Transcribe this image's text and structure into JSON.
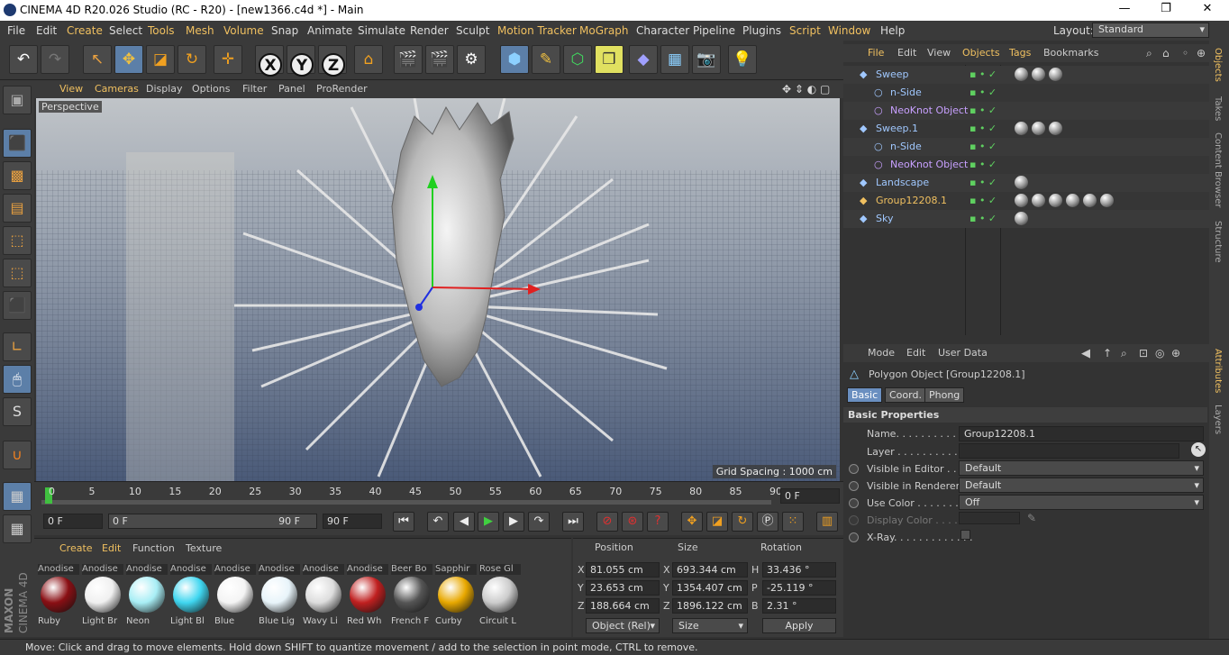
{
  "app": {
    "title": "CINEMA 4D R20.026 Studio (RC - R20) - [new1366.c4d *] - Main",
    "window_minimize": "—",
    "window_maximize": "❐",
    "window_close": "✕"
  },
  "menubar": {
    "items": [
      "File",
      "Edit",
      "Create",
      "Select",
      "Tools",
      "Mesh",
      "Volume",
      "Snap",
      "Animate",
      "Simulate",
      "Render",
      "Sculpt",
      "Motion Tracker",
      "MoGraph",
      "Character",
      "Pipeline",
      "Plugins",
      "Script",
      "Window",
      "Help"
    ],
    "layout_label": "Layout:",
    "layout_value": "Standard"
  },
  "toolbar": {
    "axis_x": "X",
    "axis_y": "Y",
    "axis_z": "Z"
  },
  "viewport": {
    "menu": [
      "View",
      "Cameras",
      "Display",
      "Options",
      "Filter",
      "Panel",
      "ProRender"
    ],
    "camera_label": "Perspective",
    "grid_spacing": "Grid Spacing : 1000 cm"
  },
  "timeline": {
    "ticks": [
      "0",
      "5",
      "10",
      "15",
      "20",
      "25",
      "30",
      "35",
      "40",
      "45",
      "50",
      "55",
      "60",
      "65",
      "70",
      "75",
      "80",
      "85",
      "90"
    ],
    "current_frame": "0 F",
    "start_frame": "0 F",
    "range_start": "0 F",
    "range_end": "90 F",
    "end_frame": "90 F"
  },
  "materials": {
    "menu": [
      "Create",
      "Edit",
      "Function",
      "Texture"
    ],
    "top_row": [
      "Anodise",
      "Anodise",
      "Anodise",
      "Anodise",
      "Anodise",
      "Anodise",
      "Anodise",
      "Anodise",
      "Beer Bo",
      "Sapphir",
      "Rose Gl"
    ],
    "items": [
      {
        "name": "Ruby",
        "color": "#8a0f14"
      },
      {
        "name": "Light Br",
        "color": "#f0f0f0"
      },
      {
        "name": "Neon",
        "color": "#a8eef5"
      },
      {
        "name": "Light Bl",
        "color": "#3fd6f0"
      },
      {
        "name": "Blue",
        "color": "#f4f4f4"
      },
      {
        "name": "Blue Lig",
        "color": "#e8f4fa"
      },
      {
        "name": "Wavy Li",
        "color": "#dddddd"
      },
      {
        "name": "Red Wh",
        "color": "#c02020"
      },
      {
        "name": "French F",
        "color": "#555555"
      },
      {
        "name": "Curby",
        "color": "#e8a800"
      },
      {
        "name": "Circuit L",
        "color": "#cccccc"
      }
    ]
  },
  "coords": {
    "headers": [
      "Position",
      "Size",
      "Rotation"
    ],
    "rows": [
      {
        "axis": "X",
        "pos": "81.055 cm",
        "size_axis": "X",
        "size": "693.344 cm",
        "rot_axis": "H",
        "rot": "33.436 °"
      },
      {
        "axis": "Y",
        "pos": "23.653 cm",
        "size_axis": "Y",
        "size": "1354.407 cm",
        "rot_axis": "P",
        "rot": "-25.119 °"
      },
      {
        "axis": "Z",
        "pos": "188.664 cm",
        "size_axis": "Z",
        "size": "1896.122 cm",
        "rot_axis": "B",
        "rot": "2.31 °"
      }
    ],
    "mode": "Object (Rel)",
    "size_mode": "Size",
    "apply": "Apply"
  },
  "objects": {
    "menu": [
      "File",
      "Edit",
      "View",
      "Objects",
      "Tags",
      "Bookmarks"
    ],
    "items": [
      {
        "name": "Sweep",
        "indent": 0,
        "color": "#a0c8ff"
      },
      {
        "name": "n-Side",
        "indent": 1,
        "color": "#a0c8ff"
      },
      {
        "name": "NeoKnot Object",
        "indent": 1,
        "color": "#c8a0ff"
      },
      {
        "name": "Sweep.1",
        "indent": 0,
        "color": "#a0c8ff"
      },
      {
        "name": "n-Side",
        "indent": 1,
        "color": "#a0c8ff"
      },
      {
        "name": "NeoKnot Object",
        "indent": 1,
        "color": "#c8a0ff"
      },
      {
        "name": "Landscape",
        "indent": 0,
        "color": "#a0c8ff"
      },
      {
        "name": "Group12208.1",
        "indent": 0,
        "color": "#f0c060"
      },
      {
        "name": "Sky",
        "indent": 0,
        "color": "#a0c8ff"
      }
    ]
  },
  "attributes": {
    "menu": [
      "Mode",
      "Edit",
      "User Data"
    ],
    "object_title": "Polygon Object [Group12208.1]",
    "tabs": [
      "Basic",
      "Coord.",
      "Phong"
    ],
    "section": "Basic Properties",
    "name_label": "Name. . . . . . . . . . . . .",
    "name_value": "Group12208.1",
    "layer_label": "Layer . . . . . . . . . . . . .",
    "vis_editor_label": "Visible in Editor . . .",
    "vis_editor_value": "Default",
    "vis_render_label": "Visible in Renderer",
    "vis_render_value": "Default",
    "use_color_label": "Use Color . . . . . . . .",
    "use_color_value": "Off",
    "display_color_label": "Display Color . . . .",
    "xray_label": "X-Ray. . . . . . . . . . . . ."
  },
  "side_tabs": [
    "Objects",
    "Takes",
    "Content Browser",
    "Structure",
    "Attributes",
    "Layers"
  ],
  "status": "Move: Click and drag to move elements. Hold down SHIFT to quantize movement / add to the selection in point mode, CTRL to remove.",
  "brand": {
    "line1": "MAXON",
    "line2": "CINEMA 4D"
  }
}
